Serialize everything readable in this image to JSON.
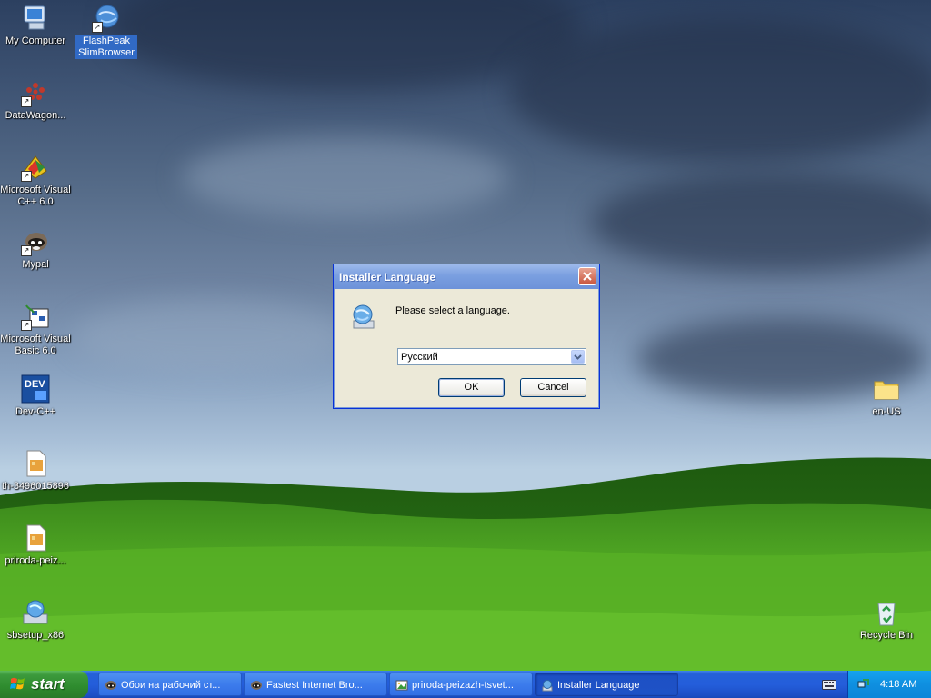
{
  "desktop": {
    "icons": [
      {
        "label": "My Computer",
        "icon": "my-computer-icon",
        "selected": false
      },
      {
        "label": "FlashPeak SlimBrowser",
        "icon": "slimbrowser-globe-icon",
        "selected": true
      },
      {
        "label": "DataWagon...",
        "icon": "datawagon-icon",
        "selected": false
      },
      {
        "label": "Microsoft Visual C++ 6.0",
        "icon": "visual-cpp-icon",
        "selected": false
      },
      {
        "label": "Mypal",
        "icon": "mypal-raccoon-icon",
        "selected": false
      },
      {
        "label": "Microsoft Visual Basic 6.0",
        "icon": "visual-basic-icon",
        "selected": false
      },
      {
        "label": "Dev-C++",
        "icon": "dev-cpp-icon",
        "selected": false
      },
      {
        "label": "th-3496015896",
        "icon": "image-file-icon",
        "selected": false
      },
      {
        "label": "priroda-peiz...",
        "icon": "image-file-icon",
        "selected": false
      },
      {
        "label": "sbsetup_x86",
        "icon": "setup-icon",
        "selected": false
      },
      {
        "label": "en-US",
        "icon": "folder-icon",
        "selected": false
      },
      {
        "label": "Recycle Bin",
        "icon": "recycle-bin-icon",
        "selected": false
      }
    ]
  },
  "dialog": {
    "title": "Installer Language",
    "prompt": "Please select a language.",
    "language_selected": "Русский",
    "ok_label": "OK",
    "cancel_label": "Cancel",
    "icon": "installer-globe-icon"
  },
  "taskbar": {
    "start_label": "start",
    "tasks": [
      {
        "label": "Обои на рабочий ст...",
        "icon": "mypal-raccoon-icon",
        "active": false
      },
      {
        "label": "Fastest Internet Bro...",
        "icon": "mypal-raccoon-icon",
        "active": false
      },
      {
        "label": "priroda-peizazh-tsvet...",
        "icon": "image-viewer-icon",
        "active": false
      },
      {
        "label": "Installer Language",
        "icon": "installer-globe-icon",
        "active": true
      }
    ],
    "clock": "4:18 AM"
  },
  "colors": {
    "taskbar_blue": "#245edb",
    "start_green": "#3c9a3c",
    "dialog_face": "#ece9d8",
    "title_blue": "#7a9fe0",
    "close_red": "#c8553d"
  }
}
